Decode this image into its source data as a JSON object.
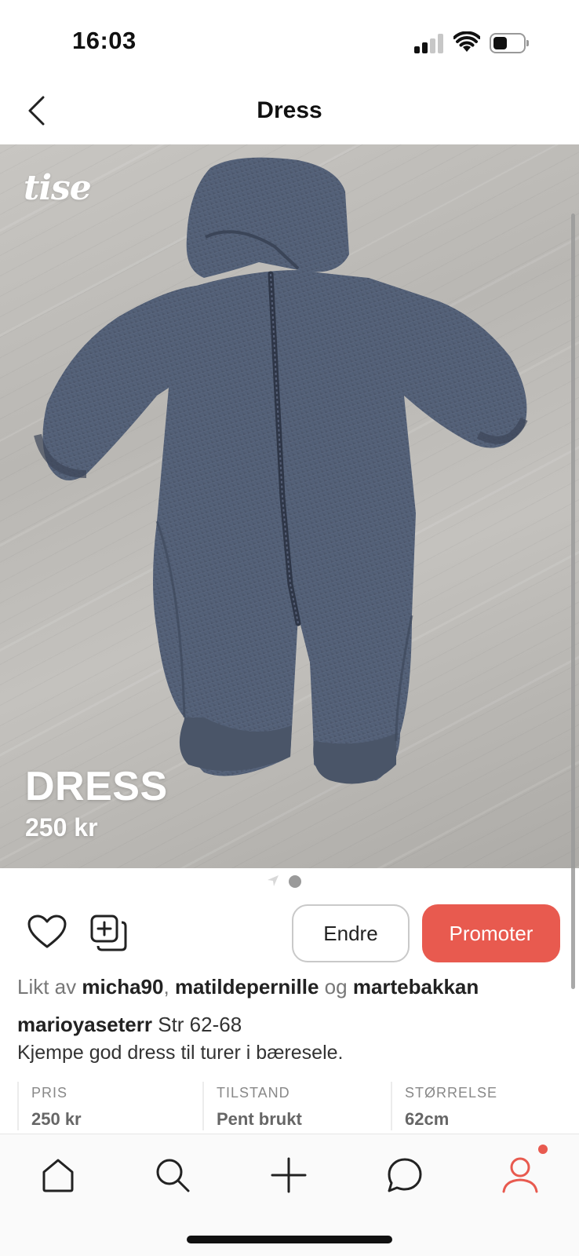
{
  "status_bar": {
    "time": "16:03"
  },
  "header": {
    "title": "Dress"
  },
  "hero": {
    "watermark": "tise",
    "overlay_title": "DRESS",
    "overlay_price": "250 kr"
  },
  "pager": {
    "page_count": 1,
    "current": 1
  },
  "actions": {
    "edit_label": "Endre",
    "promote_label": "Promoter",
    "accent_color": "#e85a4f"
  },
  "likes": {
    "prefix": "Likt av",
    "user1": "micha90",
    "user2": "matildepernille",
    "conjunction": "og",
    "user3": "martebakkan"
  },
  "description": {
    "username": "marioyaseterr",
    "size_text": "Str 62-68",
    "body": "Kjempe god dress til turer i bæresele."
  },
  "details": [
    {
      "key": "PRIS",
      "value": "250 kr"
    },
    {
      "key": "TILSTAND",
      "value": "Pent brukt"
    },
    {
      "key": "STØRRELSE",
      "value": "62cm"
    }
  ],
  "tab_bar": {
    "items": [
      "home-icon",
      "search-icon",
      "plus-icon",
      "chat-icon",
      "profile-icon"
    ],
    "active": "profile-icon"
  }
}
